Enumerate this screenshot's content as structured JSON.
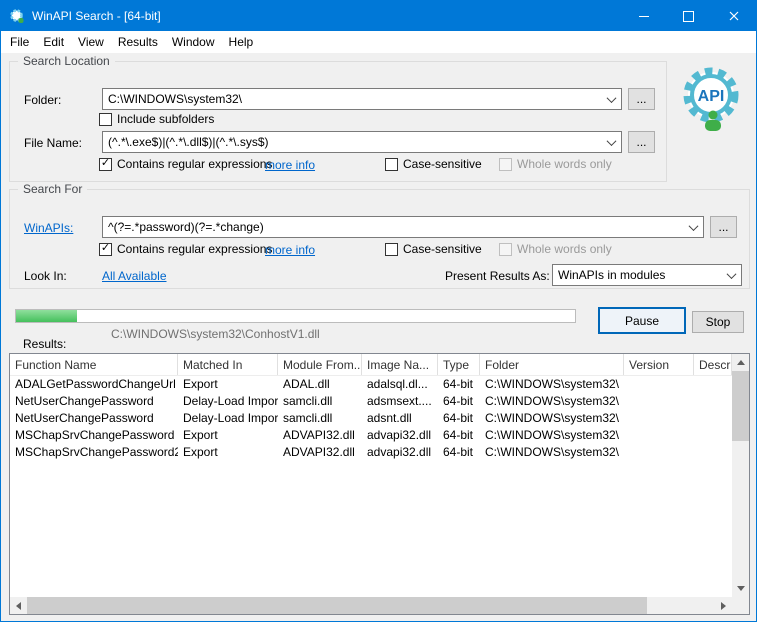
{
  "window": {
    "title": "WinAPI Search - [64-bit]"
  },
  "menu": {
    "items": [
      "File",
      "Edit",
      "View",
      "Results",
      "Window",
      "Help"
    ]
  },
  "logo": {
    "text": "API"
  },
  "search_location": {
    "group_label": "Search Location",
    "folder_label": "Folder:",
    "folder_value": "C:\\WINDOWS\\system32\\",
    "folder_browse_label": "...",
    "include_subfolders_label": "Include subfolders",
    "file_name_label": "File Name:",
    "file_name_value": "(^.*\\.exe$)|(^.*\\.dll$)|(^.*\\.sys$)",
    "file_browse_label": "...",
    "contains_regex_label": "Contains regular expressions",
    "more_info_label": "more info",
    "case_sensitive_label": "Case-sensitive",
    "whole_words_label": "Whole words only"
  },
  "search_for": {
    "group_label": "Search For",
    "winapis_label": "WinAPIs:",
    "winapis_value": "^(?=.*password)(?=.*change)",
    "winapis_browse_label": "...",
    "contains_regex_label": "Contains regular expressions",
    "more_info_label": "more info",
    "case_sensitive_label": "Case-sensitive",
    "whole_words_label": "Whole words only",
    "look_in_label": "Look In:",
    "look_in_value": "All Available",
    "present_results_label": "Present Results As:",
    "present_results_value": "WinAPIs in modules"
  },
  "progress": {
    "percent": 11,
    "current_file": "C:\\WINDOWS\\system32\\ConhostV1.dll",
    "pause_label": "Pause",
    "stop_label": "Stop"
  },
  "results": {
    "label": "Results:",
    "columns": [
      "Function Name",
      "Matched In",
      "Module From...",
      "Image Na...",
      "Type",
      "Folder",
      "Version",
      "Descrip..."
    ],
    "rows": [
      [
        "ADALGetPasswordChangeUrl",
        "Export",
        "ADAL.dll",
        "adalsql.dl...",
        "64-bit",
        "C:\\WINDOWS\\system32\\",
        "",
        ""
      ],
      [
        "NetUserChangePassword",
        "Delay-Load Import",
        "samcli.dll",
        "adsmsext....",
        "64-bit",
        "C:\\WINDOWS\\system32\\",
        "",
        ""
      ],
      [
        "NetUserChangePassword",
        "Delay-Load Import",
        "samcli.dll",
        "adsnt.dll",
        "64-bit",
        "C:\\WINDOWS\\system32\\",
        "",
        ""
      ],
      [
        "MSChapSrvChangePassword",
        "Export",
        "ADVAPI32.dll",
        "advapi32.dll",
        "64-bit",
        "C:\\WINDOWS\\system32\\",
        "",
        ""
      ],
      [
        "MSChapSrvChangePassword2",
        "Export",
        "ADVAPI32.dll",
        "advapi32.dll",
        "64-bit",
        "C:\\WINDOWS\\system32\\",
        "",
        ""
      ]
    ]
  },
  "colors": {
    "accent": "#0078d7",
    "progress_fill": "#45c05c",
    "link": "#0066cc"
  },
  "icons": {
    "app": "gear-api-icon",
    "minimize": "minimize-icon",
    "maximize": "maximize-icon",
    "close": "close-icon",
    "combo_arrow": "chevron-down-icon",
    "checkmark": "check-icon",
    "scroll_arrows": "triangle-icons"
  }
}
